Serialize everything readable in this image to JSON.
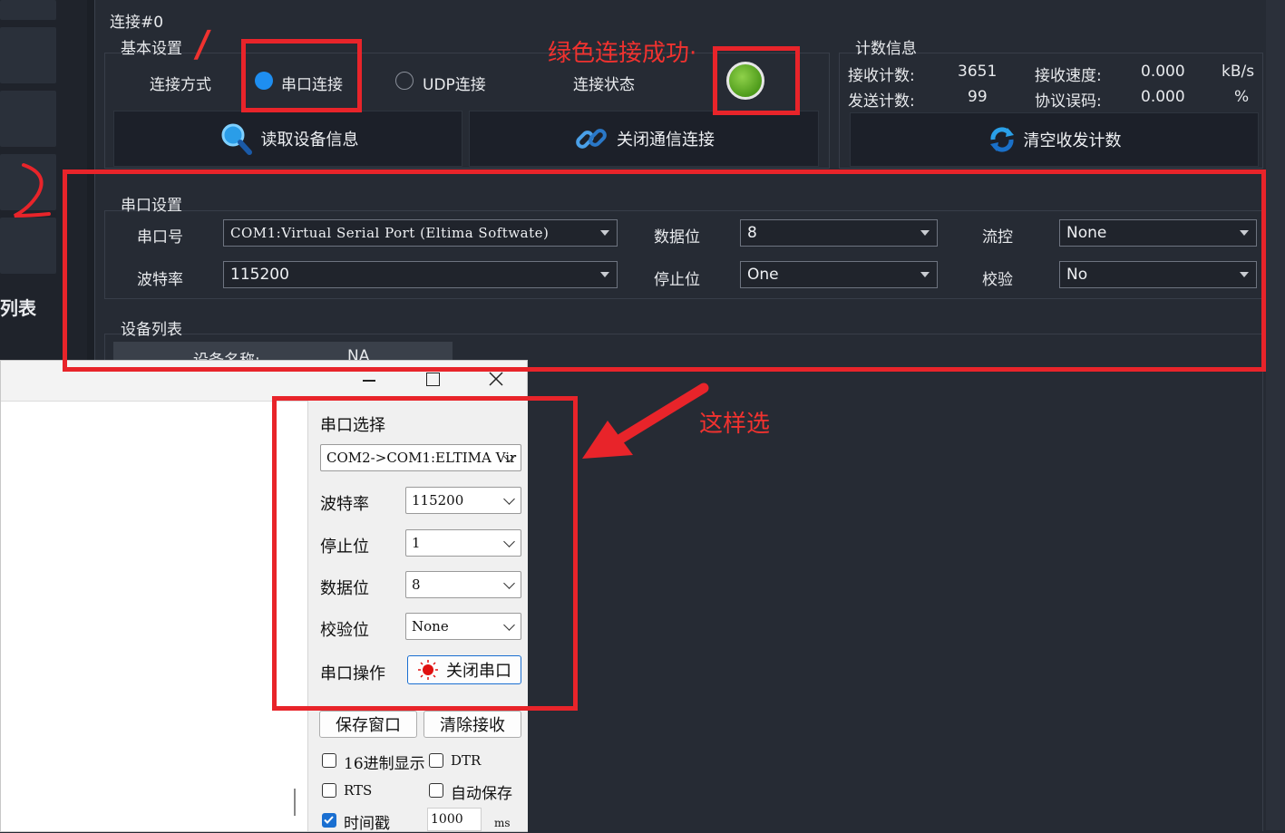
{
  "left_panel": {
    "label": "列表"
  },
  "connection": {
    "title": "连接#0",
    "basic_group": "基本设置",
    "mode_label": "连接方式",
    "serial_option": "串口连接",
    "udp_option": "UDP连接",
    "status_label": "连接状态",
    "read_device_btn": "读取设备信息",
    "close_conn_btn": "关闭通信连接"
  },
  "counts": {
    "group": "计数信息",
    "recv_count_label": "接收计数:",
    "recv_count": "3651",
    "recv_speed_label": "接收速度:",
    "recv_speed": "0.000",
    "recv_speed_unit": "kB/s",
    "send_count_label": "发送计数:",
    "send_count": "99",
    "proto_err_label": "协议误码:",
    "proto_err": "0.000",
    "proto_err_unit": "%",
    "clear_btn": "清空收发计数"
  },
  "serial": {
    "group": "串口设置",
    "port_label": "串口号",
    "port_value": "COM1:Virtual Serial Port (Eltima Softwate)",
    "baud_label": "波特率",
    "baud_value": "115200",
    "databits_label": "数据位",
    "databits_value": "8",
    "stopbits_label": "停止位",
    "stopbits_value": "One",
    "flow_label": "流控",
    "flow_value": "None",
    "parity_label": "校验",
    "parity_value": "No"
  },
  "device_list": {
    "group": "设备列表",
    "name_label": "设备名称:",
    "name_value": "NA"
  },
  "annotations": {
    "num1": "/",
    "num2": "2",
    "green_success": "绿色连接成功·",
    "choose_like_this": "这样选",
    "color": "#e8242a"
  },
  "dialog": {
    "port_select_label": "串口选择",
    "port_select_value": "COM2->COM1:ELTIMA Vir",
    "baud_label": "波特率",
    "baud_value": "115200",
    "stop_label": "停止位",
    "stop_value": "1",
    "data_label": "数据位",
    "data_value": "8",
    "parity_label": "校验位",
    "parity_value": "None",
    "op_label": "串口操作",
    "close_port_btn": "关闭串口",
    "save_window_btn": "保存窗口",
    "clear_recv_btn": "清除接收",
    "hex_display": "16进制显示",
    "dtr": "DTR",
    "rts": "RTS",
    "auto_save": "自动保存",
    "timestamp": "时间戳",
    "timestamp_ms": "1000",
    "ms_unit": "ms"
  }
}
